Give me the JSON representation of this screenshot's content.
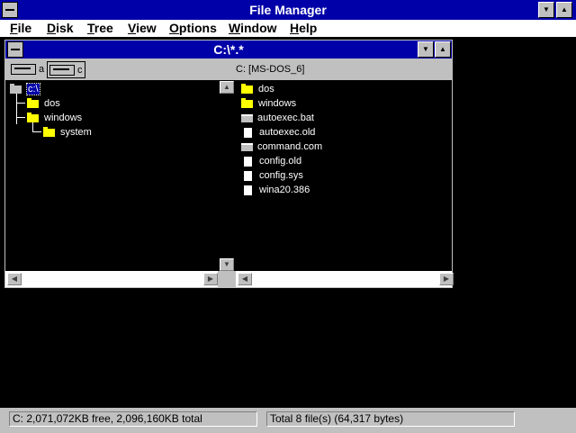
{
  "app": {
    "title": "File Manager"
  },
  "menu": [
    "File",
    "Disk",
    "Tree",
    "View",
    "Options",
    "Window",
    "Help"
  ],
  "window": {
    "title": "C:\\*.*",
    "drives": [
      {
        "letter": "a"
      },
      {
        "letter": "c",
        "selected": true
      }
    ],
    "volume_label": "C: [MS-DOS_6]",
    "tree": [
      {
        "label": "c:\\",
        "selected": true
      },
      {
        "label": "dos"
      },
      {
        "label": "windows"
      },
      {
        "label": "system"
      }
    ],
    "files": [
      {
        "name": "dos",
        "type": "folder"
      },
      {
        "name": "windows",
        "type": "folder"
      },
      {
        "name": "autoexec.bat",
        "type": "program"
      },
      {
        "name": "autoexec.old",
        "type": "document"
      },
      {
        "name": "command.com",
        "type": "program"
      },
      {
        "name": "config.old",
        "type": "document"
      },
      {
        "name": "config.sys",
        "type": "document"
      },
      {
        "name": "wina20.386",
        "type": "document"
      }
    ]
  },
  "status": {
    "left": "C: 2,071,072KB free,  2,096,160KB total",
    "right": "Total 8 file(s) (64,317 bytes)"
  }
}
